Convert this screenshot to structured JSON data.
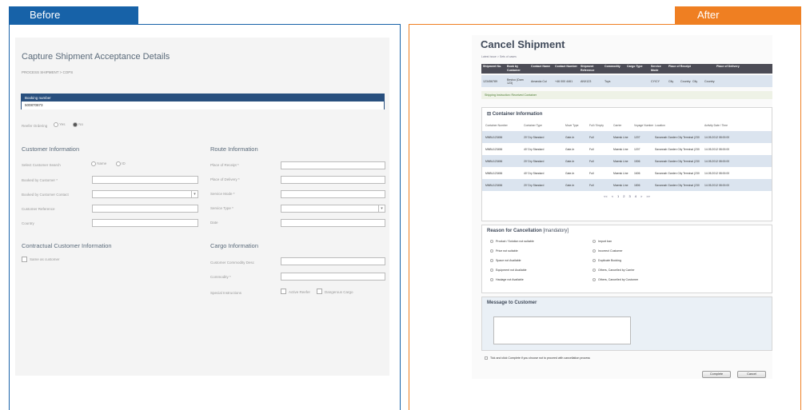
{
  "tabs": {
    "before": "Before",
    "after": "After"
  },
  "before": {
    "title": "Capture Shipment Acceptance Details",
    "breadcrumb": "PROCESS SHIPMENT > COPS",
    "booking_header": "Booking number",
    "booking_value": "500870873",
    "reefer_label": "Reefer Ordering",
    "reefer_yes": "Yes",
    "reefer_no": "No",
    "customer_heading": "Customer Information",
    "route_heading": "Route Information",
    "customer_search_label": "Select Customer Search",
    "search_opt1": "Name",
    "search_opt2": "ID",
    "customer_fields": [
      "Booked by Customer *",
      "Booked by Customer Contact",
      "Customer Reference",
      "Country"
    ],
    "route_fields": [
      "Place of Receipt *",
      "Place of Delivery *",
      "Service Mode *",
      "Service Type *",
      "Date"
    ],
    "contractual_heading": "Contractual Customer Information",
    "same_as_customer": "Same as customer",
    "cargo_heading": "Cargo Information",
    "cargo_fields": [
      "Customer Commodity Desc",
      "Commodity *",
      "Special Instructions"
    ],
    "active_reefer": "Active Reefer",
    "dangerous_cargo": "Dangerous Cargo"
  },
  "after": {
    "title": "Cancel Shipment",
    "breadcrumb": "Latest Issue > Sets of cases",
    "shipment_headers": [
      "Shipment No.",
      "Book by Customer",
      "Contact Name",
      "Contact Number",
      "Shipment Reference",
      "Commodity",
      "Cargo Type",
      "Service Mode",
      "Place of Receipt",
      "",
      "Place of Delivery",
      ""
    ],
    "shipment_row": [
      "123456789",
      "Bestco (Dam 123)",
      "Amanda Cui",
      "+46 000 4461",
      "ANX123",
      "Toys",
      "",
      "CY/CY",
      "City",
      "Country",
      "City",
      "Country"
    ],
    "shipping_instruction": "Shipping Instruction: Received Container",
    "container_heading": "Container Information",
    "container_headers": [
      "Container Number",
      "Container Type",
      "Move Type",
      "Full / Empty",
      "Carrier",
      "Voyage Number",
      "Location",
      "Activity Date / Time"
    ],
    "container_rows": [
      [
        "MNBU123456",
        "20' Dry Standard",
        "Gate-In",
        "Full",
        "Maersk Line",
        "1207",
        "Savannah Garden City Terminal (230",
        "14.05.2012 08:00:00"
      ],
      [
        "MNBU123456",
        "40' Dry Standard",
        "Gate-In",
        "Full",
        "Maersk Line",
        "1207",
        "Savannah Garden City Terminal (230",
        "14.05.2012 08:00:00"
      ],
      [
        "MNBU123456",
        "20' Dry Standard",
        "Gate-In",
        "Full",
        "Maersk Line",
        "1506",
        "Savannah Garden City Terminal (230",
        "14.05.2012 08:00:00"
      ],
      [
        "MNBU123456",
        "40' Dry Standard",
        "Gate-In",
        "Full",
        "Maersk Line",
        "1606",
        "Savannah Garden City Terminal (230",
        "14.05.2012 08:00:00"
      ],
      [
        "MNBU123456",
        "20' Dry Standard",
        "Gate-In",
        "Full",
        "Maersk Line",
        "1806",
        "Savannah Garden City Terminal (230",
        "14.05.2012 08:00:00"
      ]
    ],
    "pager": [
      "<<",
      "<",
      "1",
      "2",
      "3",
      "4",
      ">",
      ">>"
    ],
    "reason_heading": "Reason for Cancellation",
    "reason_mandatory": "[mandatory]",
    "reasons_left": [
      "Product / Solution not suitable",
      "Price not suitable",
      "Space not Available",
      "Equipment not Available",
      "Haulage not Available"
    ],
    "reasons_right": [
      "Import ban",
      "Incorrect Customer",
      "Duplicate Booking",
      "Others, Cancelled by Carrier",
      "Others, Cancelled by Customer"
    ],
    "message_heading": "Message to Customer",
    "tick_note": "Tick and click Complete if you choose not to proceed with cancellation process",
    "complete_btn": "Complete",
    "cancel_btn": "Cancel"
  },
  "colors": {
    "before_accent": "#1762a8",
    "after_accent": "#ef7f22",
    "header_dark": "#4c4c56",
    "row_blue": "#dbe4ef"
  }
}
